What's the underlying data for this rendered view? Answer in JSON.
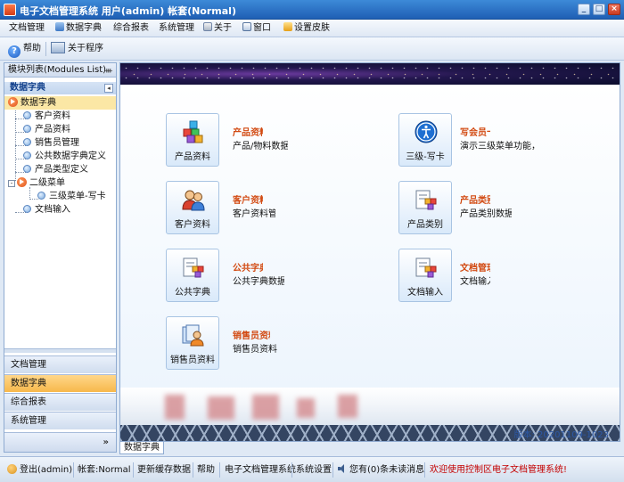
{
  "window": {
    "title": "电子文档管理系统 用户(admin) 帐套(Normal)",
    "minimize": "_",
    "maximize": "□",
    "close": "×"
  },
  "menu": [
    {
      "label": "文档管理",
      "icon": ""
    },
    {
      "label": "数据字典",
      "icon": "dictionary-icon"
    },
    {
      "label": "综合报表",
      "icon": ""
    },
    {
      "label": "系统管理",
      "icon": ""
    },
    {
      "label": "关于",
      "icon": "about-icon"
    },
    {
      "label": "窗口",
      "icon": "window-icon"
    },
    {
      "label": "设置皮肤",
      "icon": "skin-icon"
    }
  ],
  "toolbar": {
    "help_label": "帮助",
    "about_label": "关于程序"
  },
  "sidebar": {
    "title": "模块列表(Modules List)",
    "pin": "ᚒ",
    "section": "数据字典",
    "collapse": "◂",
    "tree": [
      {
        "label": "数据字典",
        "level": 0,
        "expander": true,
        "selected": true
      },
      {
        "label": "客户资料",
        "level": 1
      },
      {
        "label": "产品资料",
        "level": 1
      },
      {
        "label": "销售员管理",
        "level": 1
      },
      {
        "label": "公共数据字典定义",
        "level": 1
      },
      {
        "label": "产品类型定义",
        "level": 1
      },
      {
        "label": "二级菜单",
        "level": 0,
        "expander": true
      },
      {
        "label": "三级菜单-写卡",
        "level": 2
      },
      {
        "label": "文档输入",
        "level": 1
      }
    ],
    "nav": [
      {
        "label": "文档管理",
        "active": false
      },
      {
        "label": "数据字典",
        "active": true
      },
      {
        "label": "综合报表",
        "active": false
      },
      {
        "label": "系统管理",
        "active": false
      }
    ],
    "more": "»"
  },
  "modules": [
    {
      "label": "产品资料",
      "title": "产品资料",
      "desc": "产品/物料数据",
      "icon": "cubes-icon"
    },
    {
      "label": "三级-写卡",
      "title": "写会员卡",
      "desc": "演示三级菜单功能，写",
      "icon": "accessibility-icon"
    },
    {
      "label": "客户资料",
      "title": "客户资料",
      "desc": "客户资料管",
      "icon": "users-icon"
    },
    {
      "label": "产品类别",
      "title": "产品类别",
      "desc": "产品类别数据",
      "icon": "category-icon"
    },
    {
      "label": "公共字典",
      "title": "公共字典",
      "desc": "公共字典数据",
      "icon": "dictionary-icon"
    },
    {
      "label": "文档输入",
      "title": "文档管理",
      "desc": "文档输入",
      "icon": "document-input-icon"
    },
    {
      "label": "销售员资料",
      "title": "销售员资料",
      "desc": "销售员资料",
      "icon": "salesperson-icon"
    }
  ],
  "version": "版本: 20201109-1023",
  "doc_tab": "数据字典",
  "status": {
    "logout": "登出(admin)",
    "account": "帐套:Normal",
    "refresh_cache": "更新缓存数据",
    "help": "帮助",
    "system_name": "电子文档管理系统",
    "settings": "系统设置",
    "messages": "您有(0)条未读消息",
    "welcome": "欢迎使用控制区电子文档管理系统!"
  },
  "colors": {
    "accent": "#1f5fb4",
    "module_title": "#d24a12",
    "selected": "#fbe7a5",
    "active_nav": "#f7b84b",
    "welcome": "#c40000"
  }
}
